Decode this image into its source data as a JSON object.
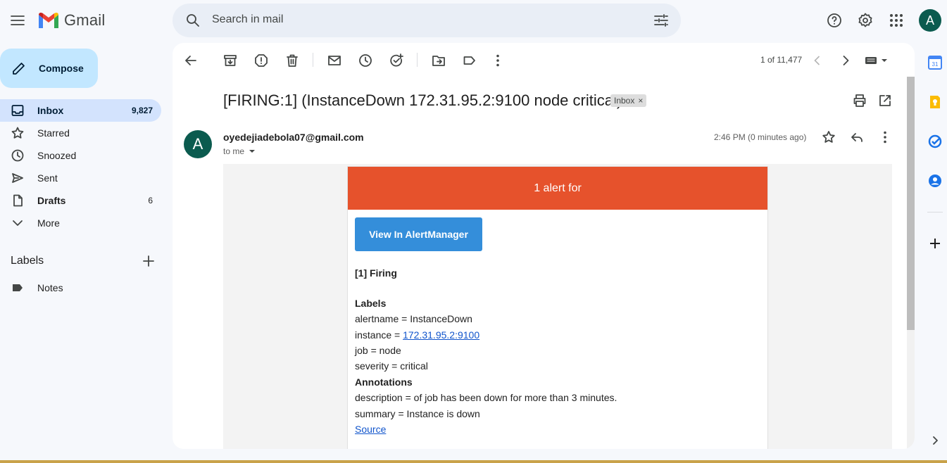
{
  "app": {
    "name": "Gmail"
  },
  "search": {
    "placeholder": "Search in mail"
  },
  "user": {
    "initial": "A"
  },
  "compose": {
    "label": "Compose"
  },
  "nav": {
    "items": [
      {
        "label": "Inbox",
        "count": "9,827",
        "icon": "inbox-icon"
      },
      {
        "label": "Starred",
        "count": "",
        "icon": "star-icon"
      },
      {
        "label": "Snoozed",
        "count": "",
        "icon": "clock-icon"
      },
      {
        "label": "Sent",
        "count": "",
        "icon": "send-icon"
      },
      {
        "label": "Drafts",
        "count": "6",
        "icon": "draft-icon"
      },
      {
        "label": "More",
        "count": "",
        "icon": "chevron-down-icon"
      }
    ]
  },
  "labels": {
    "title": "Labels",
    "items": [
      {
        "label": "Notes"
      }
    ]
  },
  "toolbar": {
    "pager": "1 of 11,477"
  },
  "email": {
    "subject": "[FIRING:1] (InstanceDown 172.31.95.2:9100 node critical)",
    "chip": "Inbox",
    "chip_close": "×",
    "sender_initial": "A",
    "sender": "oyedejiadebola07@gmail.com",
    "to": "to me",
    "time": "2:46 PM (0 minutes ago)"
  },
  "alert": {
    "header": "1 alert for",
    "button": "View In AlertManager",
    "firing": "[1] Firing",
    "labels_title": "Labels",
    "alertname": "alertname = InstanceDown",
    "instance_prefix": "instance = ",
    "instance_link": "172.31.95.2:9100",
    "job": "job = node",
    "severity": "severity = critical",
    "annotations_title": "Annotations",
    "description": "description = of job has been down for more than 3 minutes.",
    "summary": "summary = Instance is down",
    "source": "Source"
  },
  "colors": {
    "alert_header": "#e6522c",
    "button": "#348eda",
    "compose": "#c2e7ff",
    "active_nav": "#d3e3fd"
  }
}
